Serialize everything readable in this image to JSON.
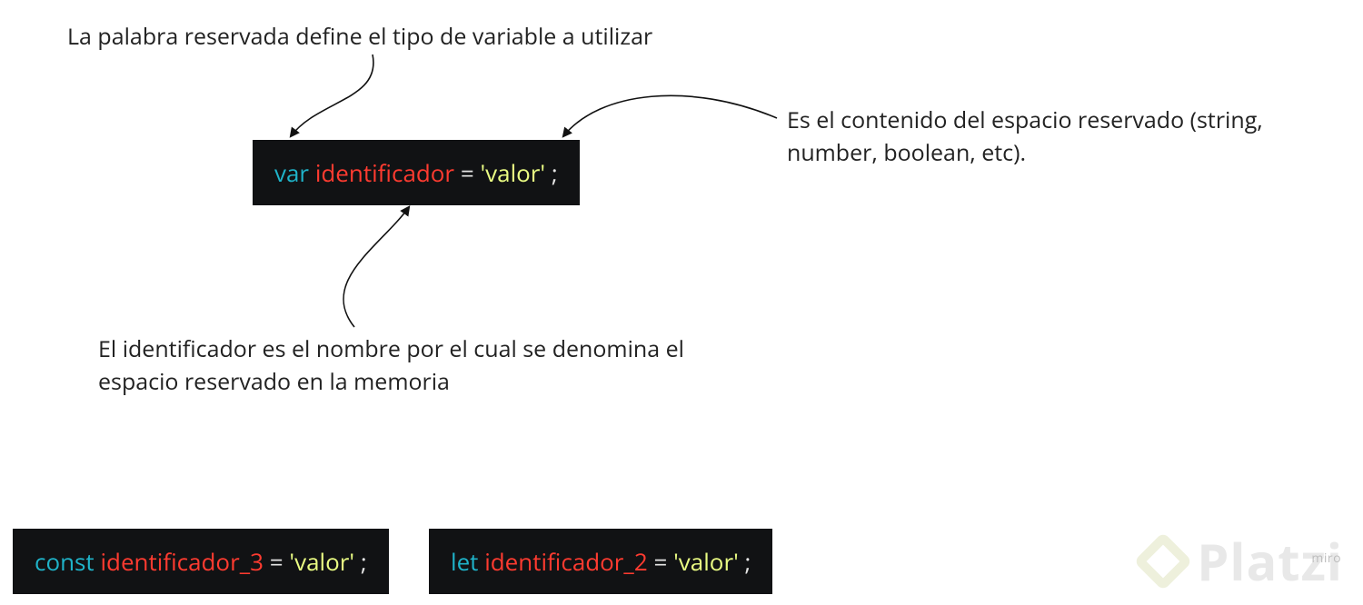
{
  "annotations": {
    "keyword": "La palabra reservada define el tipo de variable a utilizar",
    "value": "Es el contenido del espacio reservado (string, number, boolean, etc).",
    "identifier": "El identificador es el nombre por el cual se denomina el espacio reservado en la memoria"
  },
  "main_code": {
    "keyword": "var",
    "identifier": "identificador",
    "equals": "=",
    "value": "'valor'",
    "semicolon": ";"
  },
  "example_const": {
    "keyword": "const",
    "identifier": "identificador_3",
    "equals": "=",
    "value": "'valor'",
    "semicolon": ";"
  },
  "example_let": {
    "keyword": "let",
    "identifier": "identificador_2",
    "equals": "=",
    "value": "'valor'",
    "semicolon": ";"
  },
  "watermark": {
    "brand": "Platzi",
    "tool": "miro"
  }
}
